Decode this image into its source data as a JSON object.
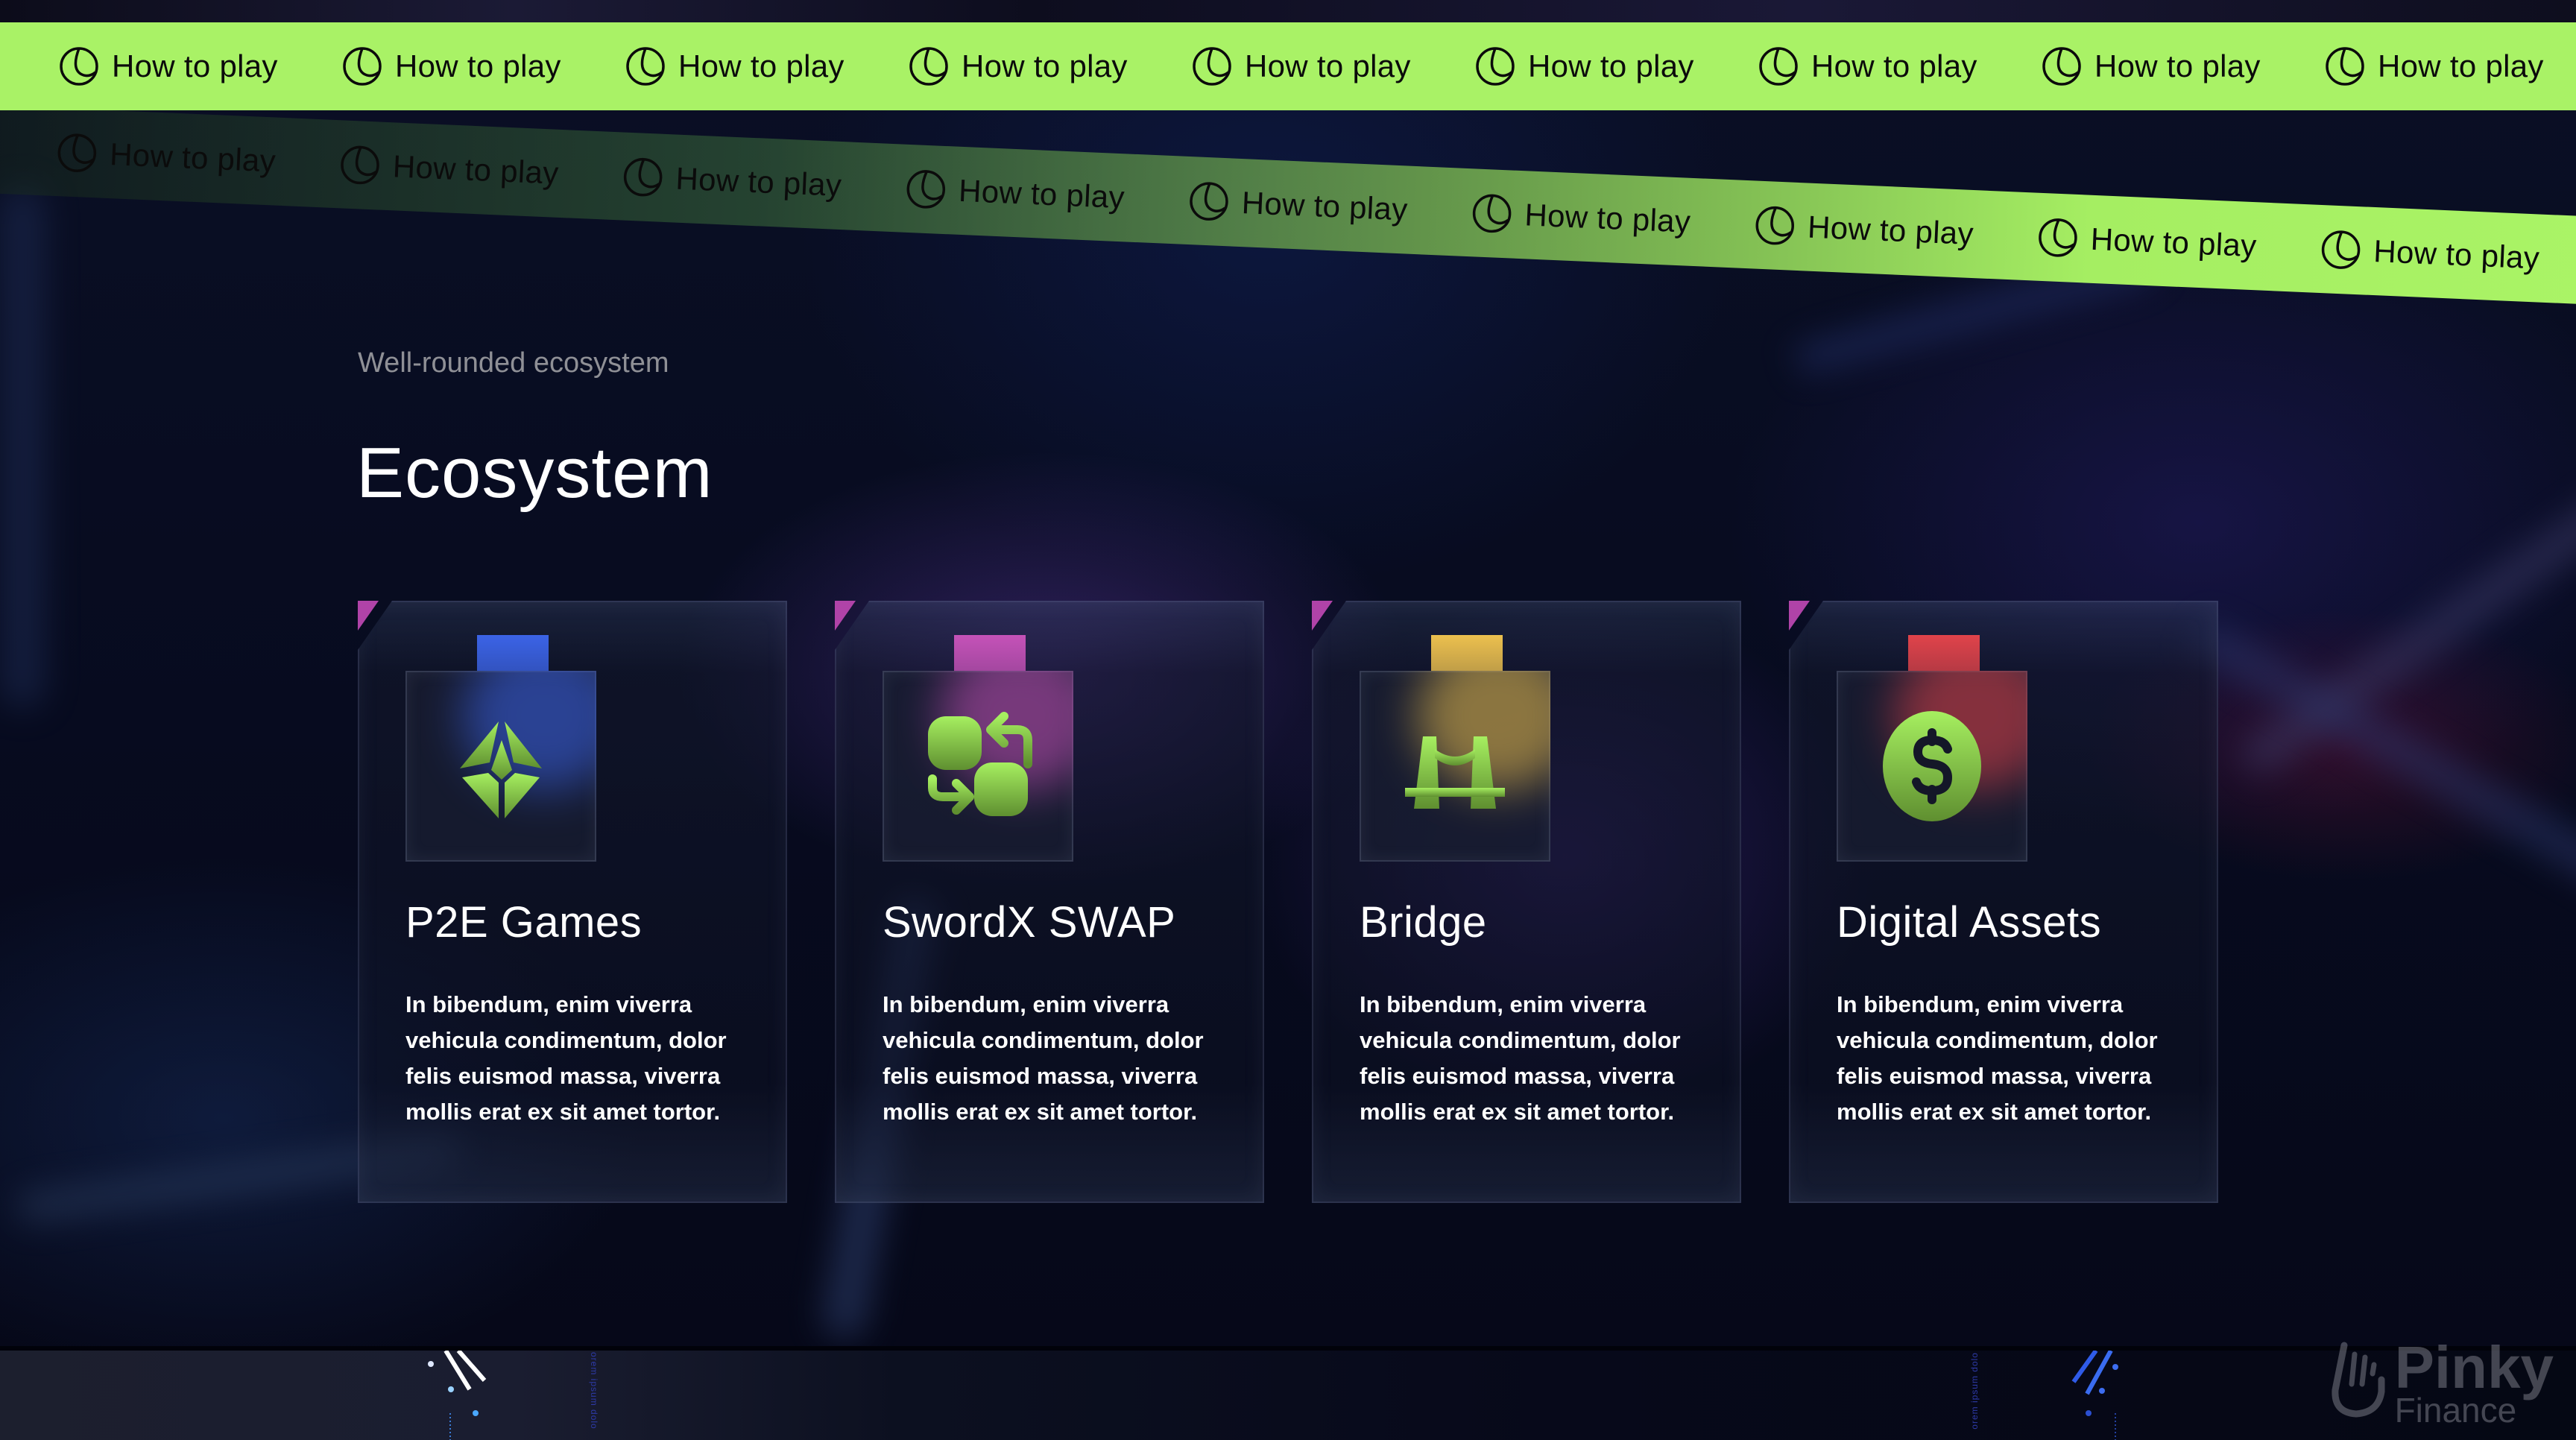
{
  "ribbon": {
    "label": "How to play",
    "icon": "pie-clock-icon",
    "color": "#a9f266",
    "repeat_main": 9,
    "repeat_tilt": 9
  },
  "section": {
    "eyebrow": "Well-rounded ecosystem",
    "heading": "Ecosystem"
  },
  "cards": [
    {
      "title": "P2E Games",
      "body": "In bibendum, enim viverra vehicula condimentum, dolor felis euismod massa, viverra mollis erat ex sit amet tortor.",
      "icon": "crystal-icon",
      "accent": "#3b63e6"
    },
    {
      "title": "SwordX SWAP",
      "body": "In bibendum, enim viverra vehicula condimentum, dolor felis euismod massa, viverra mollis erat ex sit amet tortor.",
      "icon": "swap-icon",
      "accent": "#c552b8"
    },
    {
      "title": "Bridge",
      "body": "In bibendum, enim viverra vehicula condimentum, dolor felis euismod massa, viverra mollis erat ex sit amet tortor.",
      "icon": "bridge-icon",
      "accent": "#ecc04e"
    },
    {
      "title": "Digital Assets",
      "body": "In bibendum, enim viverra vehicula condimentum, dolor felis euismod massa, viverra mollis erat ex sit amet tortor.",
      "icon": "dollar-coin-icon",
      "accent": "#e0434a"
    }
  ],
  "footer": {
    "vertical_text": "orem ipsum dolo",
    "logo": {
      "line1": "Pinky",
      "line2": "Finance"
    }
  },
  "colors": {
    "icon_green_top": "#a6ef60",
    "icon_green_bottom": "#5f8f30",
    "card_corner": "#b043a8",
    "background": "#070b1f"
  }
}
